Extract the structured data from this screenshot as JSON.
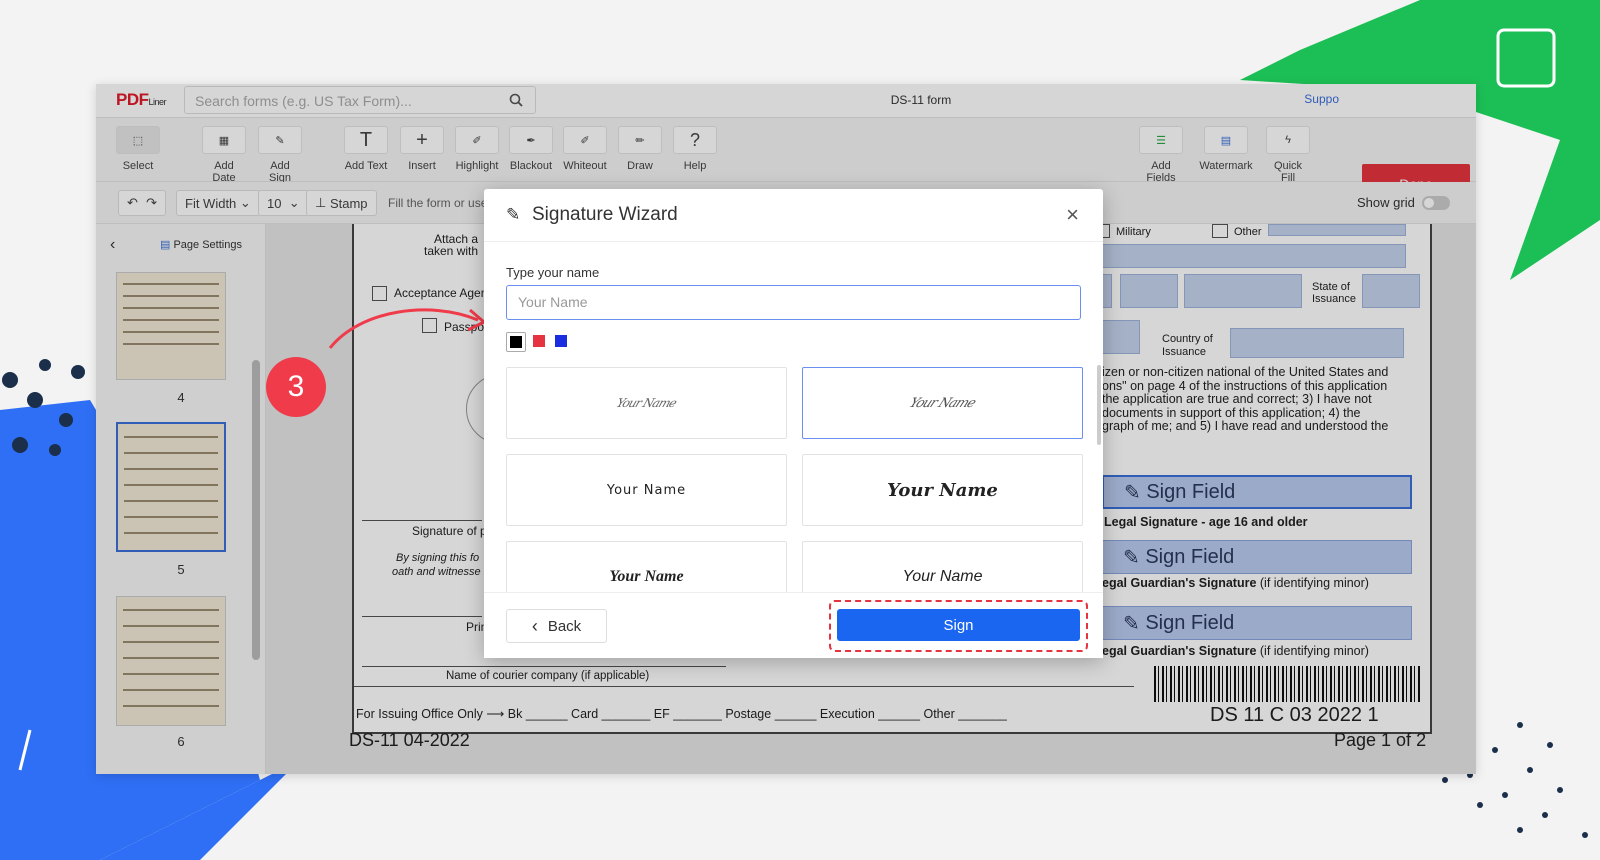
{
  "app": {
    "logo": "PDF",
    "logo_sub": "Liner",
    "search_placeholder": "Search forms (e.g. US Tax Form)...",
    "doc_title": "DS-11 form",
    "support": "Suppo",
    "done_label": "Done"
  },
  "toolbar": {
    "tools": [
      {
        "label": "Select",
        "icon": "cursor-icon"
      },
      {
        "label": "Add Date",
        "icon": "calendar-icon"
      },
      {
        "label": "Add Sign",
        "icon": "pen-icon"
      },
      {
        "label": "Add Text",
        "icon": "text-icon"
      },
      {
        "label": "Insert",
        "icon": "plus-icon"
      },
      {
        "label": "Highlight",
        "icon": "highlighter-icon"
      },
      {
        "label": "Blackout",
        "icon": "blackout-icon"
      },
      {
        "label": "Whiteout",
        "icon": "eraser-icon"
      },
      {
        "label": "Draw",
        "icon": "brush-icon"
      },
      {
        "label": "Help",
        "icon": "question-icon"
      },
      {
        "label": "Add Fields",
        "icon": "fields-icon"
      },
      {
        "label": "Watermark",
        "icon": "watermark-icon"
      },
      {
        "label": "Quick Fill",
        "icon": "bolt-icon"
      }
    ]
  },
  "toolbar2": {
    "fit": "Fit Width",
    "size": "10",
    "stamp": "Stamp",
    "hint": "Fill the form or use",
    "show_grid": "Show grid"
  },
  "sidebar": {
    "page_settings": "Page Settings",
    "pages": [
      "4",
      "5",
      "6"
    ]
  },
  "document": {
    "attach": "Attach a",
    "taken": "taken with",
    "acceptance": "Acceptance Agent",
    "passport": "Passpo",
    "military": "Military",
    "other": "Other",
    "state_issuance": "State of Issuance",
    "country_issuance": "Country of Issuance",
    "para": [
      "izen or non-citizen national of the United States and",
      "ons\" on page 4 of the instructions of this application",
      "the application are true and correct; 3) I have not",
      "documents in support of this application; 4) the",
      "graph of me; and 5) I have read and understood the"
    ],
    "signature_of": "Signature of p",
    "by_signing": "By signing this fo",
    "oath": "oath and witnesse",
    "print": "Prin",
    "sign_field": "Sign Field",
    "legal_sig": "Legal Signature - age 16 and older",
    "guardian1": "egal Guardian's Signature",
    "guardian_note": "(if identifying minor)",
    "guardian2": "egal Guardian's Signature",
    "courier": "Name of courier company (if applicable)",
    "issuing": "For Issuing Office Only",
    "bk": "Bk",
    "card": "Card",
    "ef": "EF",
    "postage": "Postage",
    "execution": "Execution",
    "other2": "Other",
    "barcode_text": "DS 11 C 03 2022 1",
    "form_id": "DS-11 04-2022",
    "page_of": "Page 1 of 2"
  },
  "modal": {
    "title": "Signature Wizard",
    "type_label": "Type your name",
    "input_value": "Your Name",
    "colors": [
      "#000000",
      "#e5343f",
      "#1a2ee0"
    ],
    "samples": [
      "Your Name",
      "Your Name",
      "Your Name",
      "Your Name",
      "Your Name",
      "Your Name"
    ],
    "back": "Back",
    "sign": "Sign"
  },
  "step_number": "3"
}
